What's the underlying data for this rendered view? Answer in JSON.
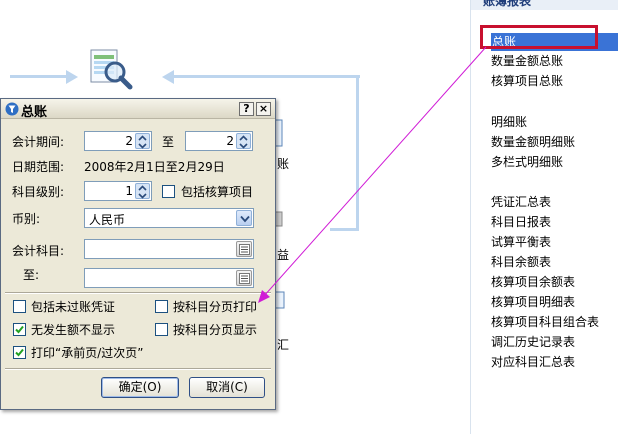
{
  "background": {
    "labels": [
      {
        "key": "zhang",
        "text": "账"
      },
      {
        "key": "yi",
        "text": "益"
      },
      {
        "key": "hui",
        "text": "汇"
      }
    ]
  },
  "panel": {
    "header": "账簿报表",
    "items": [
      "总账",
      "数量金额总账",
      "核算项目总账",
      "明细账",
      "数量金额明细账",
      "多栏式明细账",
      "凭证汇总表",
      "科目日报表",
      "试算平衡表",
      "科目余额表",
      "核算项目余额表",
      "核算项目明细表",
      "核算项目科目组合表",
      "调汇历史记录表",
      "对应科目汇总表"
    ]
  },
  "dialog": {
    "title": "总账",
    "help": "?",
    "close": "×",
    "period_label": "会计期间:",
    "period_from": "2",
    "to_label": "至",
    "period_to": "2",
    "date_range_label": "日期范围:",
    "date_range": "2008年2月1日至2月29日",
    "level_label": "科目级别:",
    "level": "1",
    "include_accounting_item": "包括核算项目",
    "currency_label": "币别:",
    "currency": "人民币",
    "account_label": "会计科目:",
    "account_to_label": "至:",
    "options": [
      {
        "label": "包括未过账凭证",
        "checked": false
      },
      {
        "label": "按科目分页打印",
        "checked": false
      },
      {
        "label": "无发生额不显示",
        "checked": true
      },
      {
        "label": "按科目分页显示",
        "checked": false
      },
      {
        "label": "打印“承前页/过次页”",
        "checked": true
      }
    ],
    "ok": "确定(O)",
    "cancel": "取消(C)"
  },
  "colors": {
    "selection": "#3a73d6",
    "highlight_box": "#c8102e",
    "arrow": "#d01bd6"
  }
}
